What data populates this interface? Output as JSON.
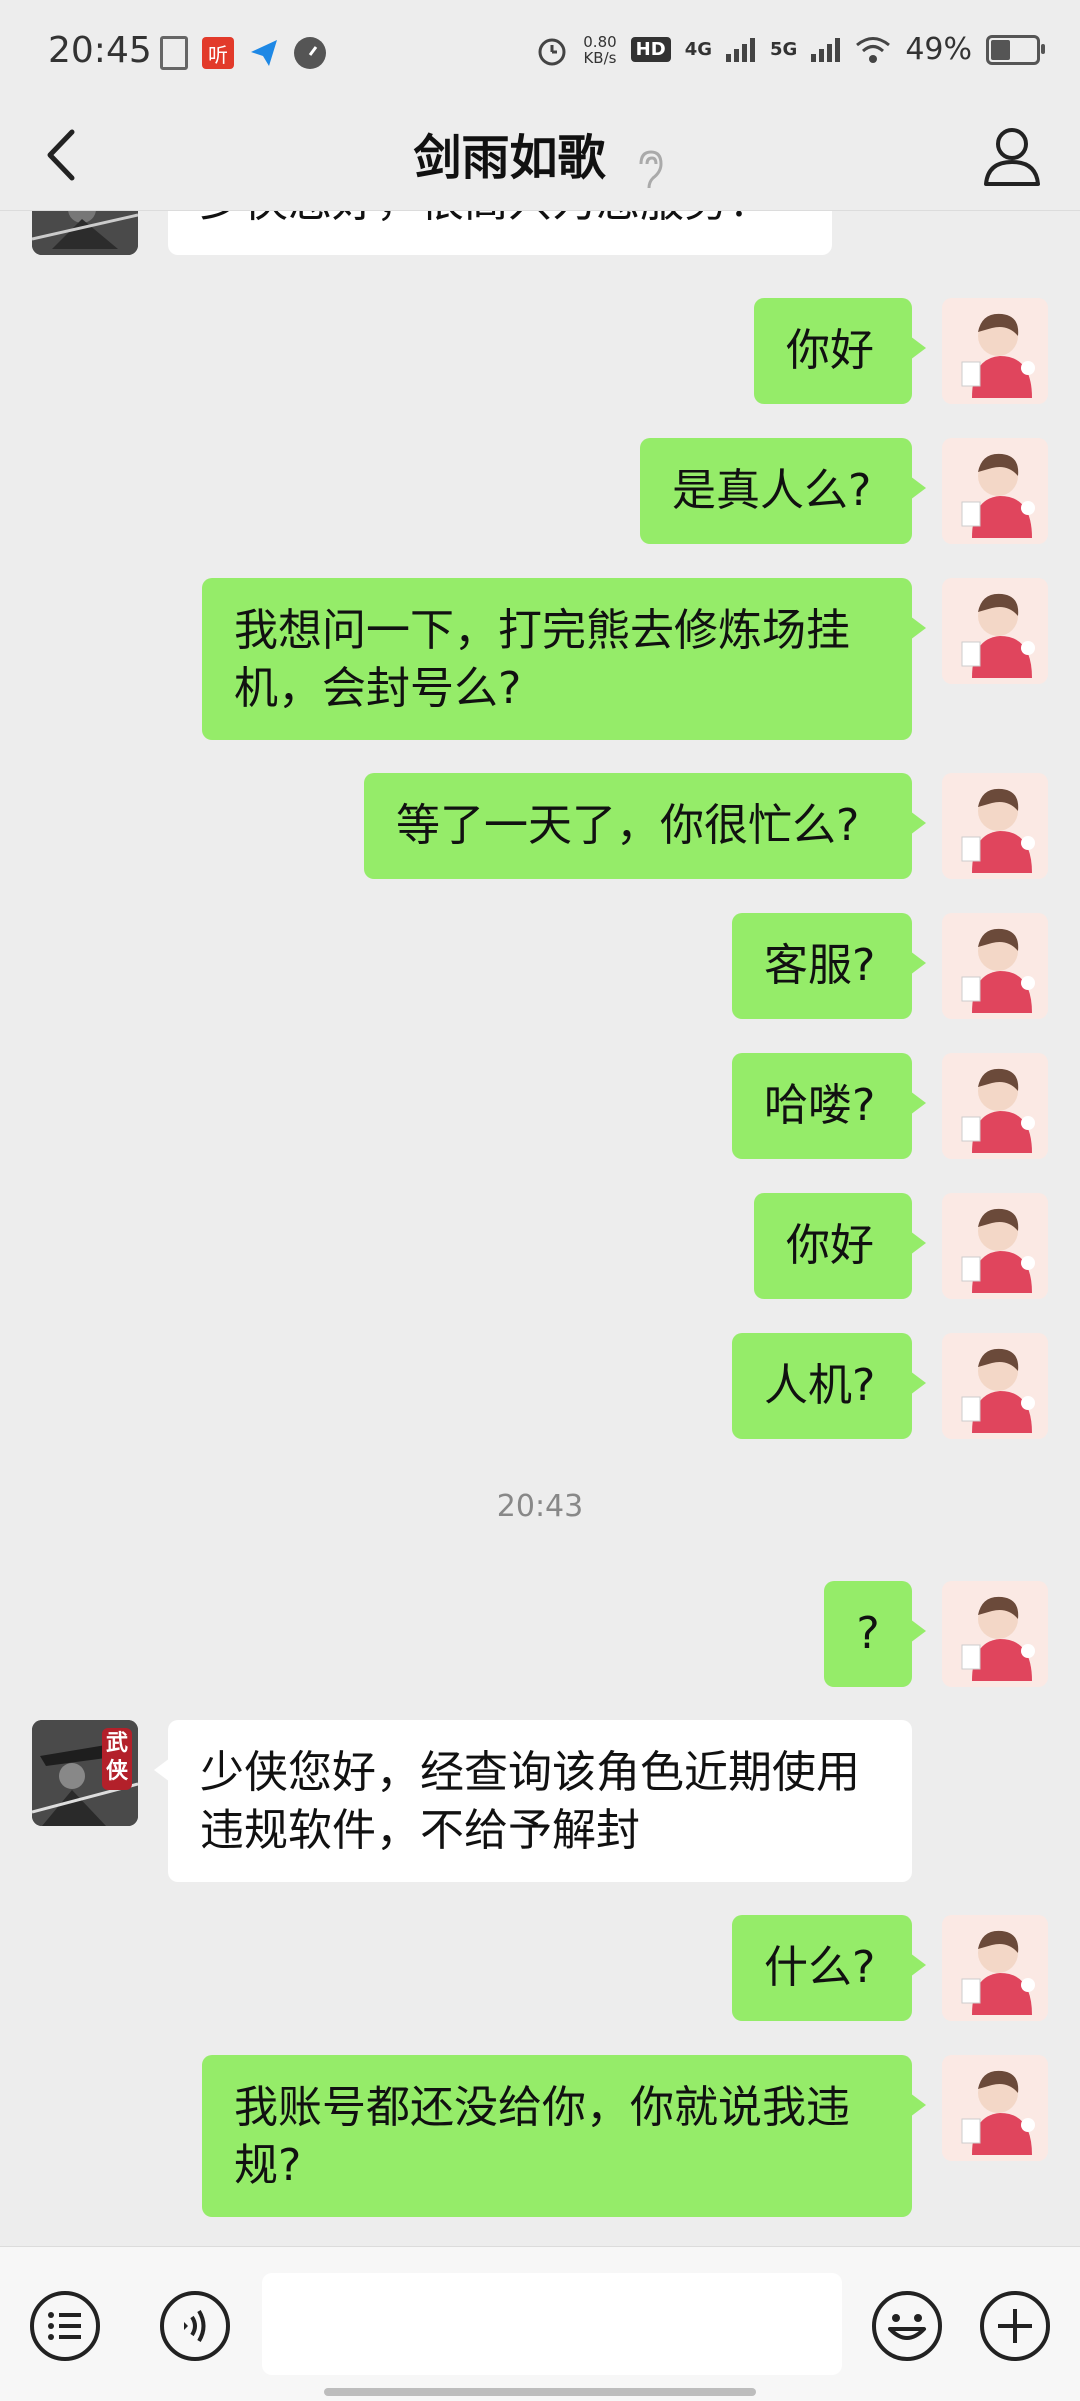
{
  "status_bar": {
    "time": "20:45",
    "net_speed_value": "0.80",
    "net_speed_unit": "KB/s",
    "hd_label": "HD",
    "sim1": "4G",
    "sim2": "5G",
    "battery": "49%",
    "ting_label": "听"
  },
  "header": {
    "title": "剑雨如歌"
  },
  "messages": [
    {
      "side": "them",
      "text": "少侠您好，很高兴为您服务！"
    },
    {
      "side": "me",
      "text": "你好"
    },
    {
      "side": "me",
      "text": "是真人么?"
    },
    {
      "side": "me",
      "text": "我想问一下，打完熊去修炼场挂机，会封号么?"
    },
    {
      "side": "me",
      "text": "等了一天了，你很忙么?"
    },
    {
      "side": "me",
      "text": "客服?"
    },
    {
      "side": "me",
      "text": "哈喽?"
    },
    {
      "side": "me",
      "text": "你好"
    },
    {
      "side": "me",
      "text": "人机?"
    },
    {
      "side": "me",
      "text": "?"
    },
    {
      "side": "them",
      "text": "少侠您好，经查询该角色近期使用违规软件，不给予解封"
    },
    {
      "side": "me",
      "text": "什么?"
    },
    {
      "side": "me",
      "text": "我账号都还没给你，你就说我违规?"
    }
  ],
  "timestamp": "20:43",
  "avatar_badge": "武侠",
  "input": {
    "value": "",
    "placeholder": ""
  },
  "colors": {
    "my_bubble": "#95ec69",
    "their_bubble": "#ffffff",
    "background": "#ededed"
  },
  "icons": {
    "back": "chevron-left-icon",
    "ear": "ear-icon",
    "profile": "person-icon",
    "menu": "list-menu-icon",
    "voice": "voice-icon",
    "emoji": "emoji-icon",
    "plus": "plus-icon"
  }
}
